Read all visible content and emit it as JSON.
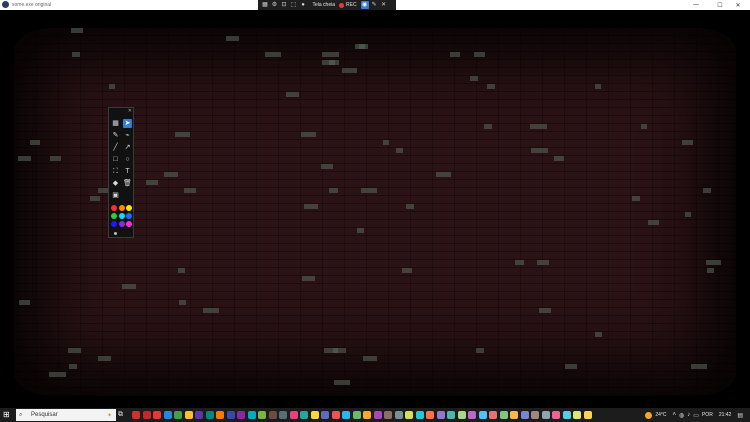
{
  "window": {
    "title": "some.exe original",
    "controls": {
      "minimize": "—",
      "maximize": "☐",
      "close": "✕"
    }
  },
  "rec_toolbar": {
    "icons": [
      "grid-icon",
      "settings-icon",
      "crop-icon",
      "region-icon",
      "drop-icon"
    ],
    "fullscreen_label": "Tela cheia",
    "rec_label": "REC",
    "rec_color": "#e53935",
    "accent": "#3a7bd5"
  },
  "palette": {
    "close_label": "✕",
    "tools": [
      {
        "name": "whiteboard-icon",
        "glyph": "▦",
        "active": false
      },
      {
        "name": "pointer-icon",
        "glyph": "➤",
        "active": true
      },
      {
        "name": "pen-icon",
        "glyph": "✎",
        "active": false
      },
      {
        "name": "dropper-icon",
        "glyph": "⌁",
        "active": false
      },
      {
        "name": "line-icon",
        "glyph": "╱",
        "active": false
      },
      {
        "name": "arrow-icon",
        "glyph": "↗",
        "active": false
      },
      {
        "name": "rectangle-icon",
        "glyph": "□",
        "active": false
      },
      {
        "name": "circle-icon",
        "glyph": "○",
        "active": false
      },
      {
        "name": "fill-icon",
        "glyph": "⛶",
        "active": false
      },
      {
        "name": "text-icon",
        "glyph": "T",
        "active": false
      },
      {
        "name": "eraser-icon",
        "glyph": "◆",
        "active": false
      },
      {
        "name": "trash-icon",
        "glyph": "🗑",
        "active": false
      },
      {
        "name": "image-icon",
        "glyph": "▣",
        "active": false
      }
    ],
    "colors": [
      "#ff2d2d",
      "#ff8c00",
      "#ffe600",
      "#2ecc40",
      "#00e5ff",
      "#1e6bff",
      "#1a1aff",
      "#8a2be2",
      "#ff2dd4"
    ]
  },
  "taskbar": {
    "search_placeholder": "Pesquisar",
    "weather_temp": "24°C",
    "language": "POR",
    "time": "21:42",
    "pinned_colors": [
      "#d32f2f",
      "#c62828",
      "#e53935",
      "#1e88e5",
      "#43a047",
      "#fbc02d",
      "#5e35b1",
      "#00897b",
      "#f57c00",
      "#3949ab",
      "#8e24aa",
      "#00acc1",
      "#7cb342",
      "#6d4c41",
      "#546e7a",
      "#ec407a",
      "#26a69a",
      "#fdd835",
      "#5c6bc0",
      "#ef5350",
      "#29b6f6",
      "#66bb6a",
      "#ffa726",
      "#ab47bc",
      "#8d6e63",
      "#78909c",
      "#d4e157",
      "#26c6da",
      "#ff7043",
      "#9575cd",
      "#4db6ac",
      "#aed581",
      "#ba68c8",
      "#4fc3f7",
      "#e57373",
      "#81c784",
      "#ffb74d",
      "#7986cb",
      "#a1887f",
      "#90a4ae",
      "#f06292",
      "#4dd0e1",
      "#dce775",
      "#ffd54f"
    ]
  }
}
